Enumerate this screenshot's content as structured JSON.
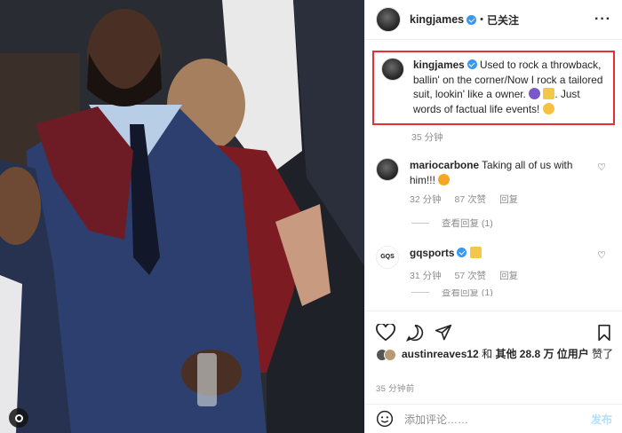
{
  "post": {
    "username": "kingjames",
    "separator": "•",
    "follow_status": "已关注",
    "more_label": "···"
  },
  "caption": {
    "username": "kingjames",
    "text_part1": "Used to rock a throwback, ballin' on the corner/Now I rock a tailored suit, lookin' like a owner.",
    "text_part2": ". Just words of factual life events!",
    "time": "35 分钟"
  },
  "comments": [
    {
      "username": "mariocarbone",
      "text": "Taking all of us with him!!!",
      "time": "32 分钟",
      "likes": "87 次赞",
      "reply_label": "回复",
      "view_replies": "查看回复 (1)",
      "avatar_icon": "user-avatar"
    },
    {
      "username": "gqsports",
      "avatar_text": "GQS",
      "time": "31 分钟",
      "likes": "57 次赞",
      "reply_label": "回复",
      "view_replies": "查看回复 (1)"
    }
  ],
  "likes": {
    "liker": "austinreaves12",
    "connector": "和",
    "others": "其他 28.8 万 位用户",
    "suffix": "赞了"
  },
  "timestamp": "35 分钟前",
  "add_comment": {
    "placeholder": "添加评论……",
    "post_label": "发布"
  },
  "colors": {
    "highlight_border": "#e5302f",
    "verified": "#3897f0",
    "post_button": "#b2dffc"
  }
}
